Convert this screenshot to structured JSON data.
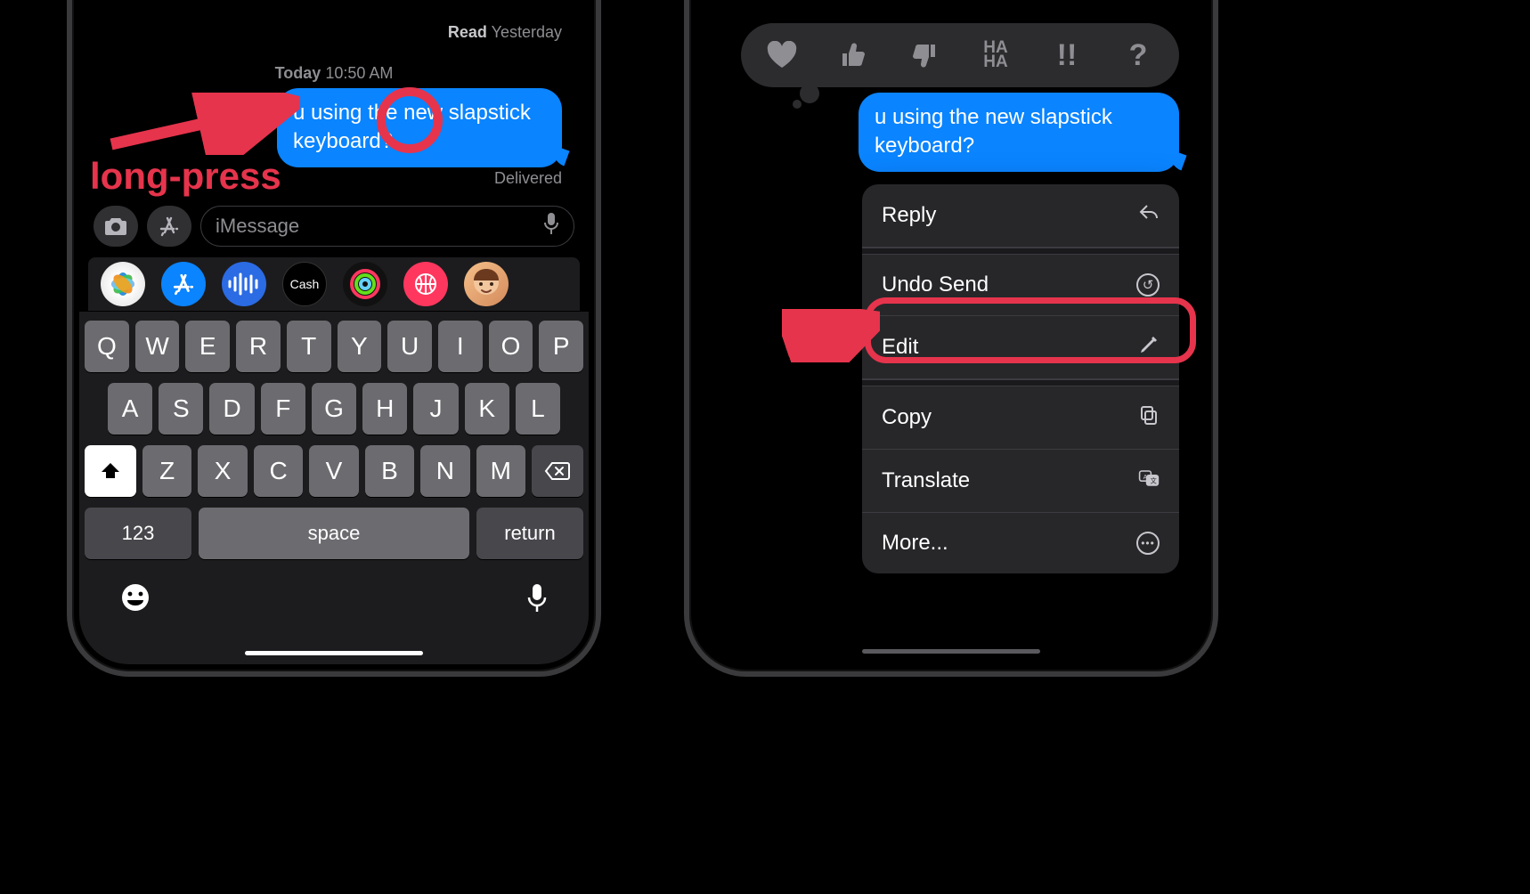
{
  "left": {
    "read_label": "Read",
    "read_time": "Yesterday",
    "timestamp_day": "Today",
    "timestamp_time": "10:50 AM",
    "message": "u using the new slapstick keyboard?",
    "delivered": "Delivered",
    "input_placeholder": "iMessage",
    "apps": {
      "cash_label": "Cash"
    },
    "keyboard": {
      "row1": [
        "Q",
        "W",
        "E",
        "R",
        "T",
        "Y",
        "U",
        "I",
        "O",
        "P"
      ],
      "row2": [
        "A",
        "S",
        "D",
        "F",
        "G",
        "H",
        "J",
        "K",
        "L"
      ],
      "row3": [
        "Z",
        "X",
        "C",
        "V",
        "B",
        "N",
        "M"
      ],
      "numbers": "123",
      "space": "space",
      "return": "return"
    },
    "annotation": "long-press"
  },
  "right": {
    "message": "u using the new slapstick keyboard?",
    "tapbacks": [
      "heart",
      "thumbs-up",
      "thumbs-down",
      "haha",
      "exclaim",
      "question"
    ],
    "menu": {
      "reply": "Reply",
      "undo": "Undo Send",
      "edit": "Edit",
      "copy": "Copy",
      "translate": "Translate",
      "more": "More..."
    }
  }
}
